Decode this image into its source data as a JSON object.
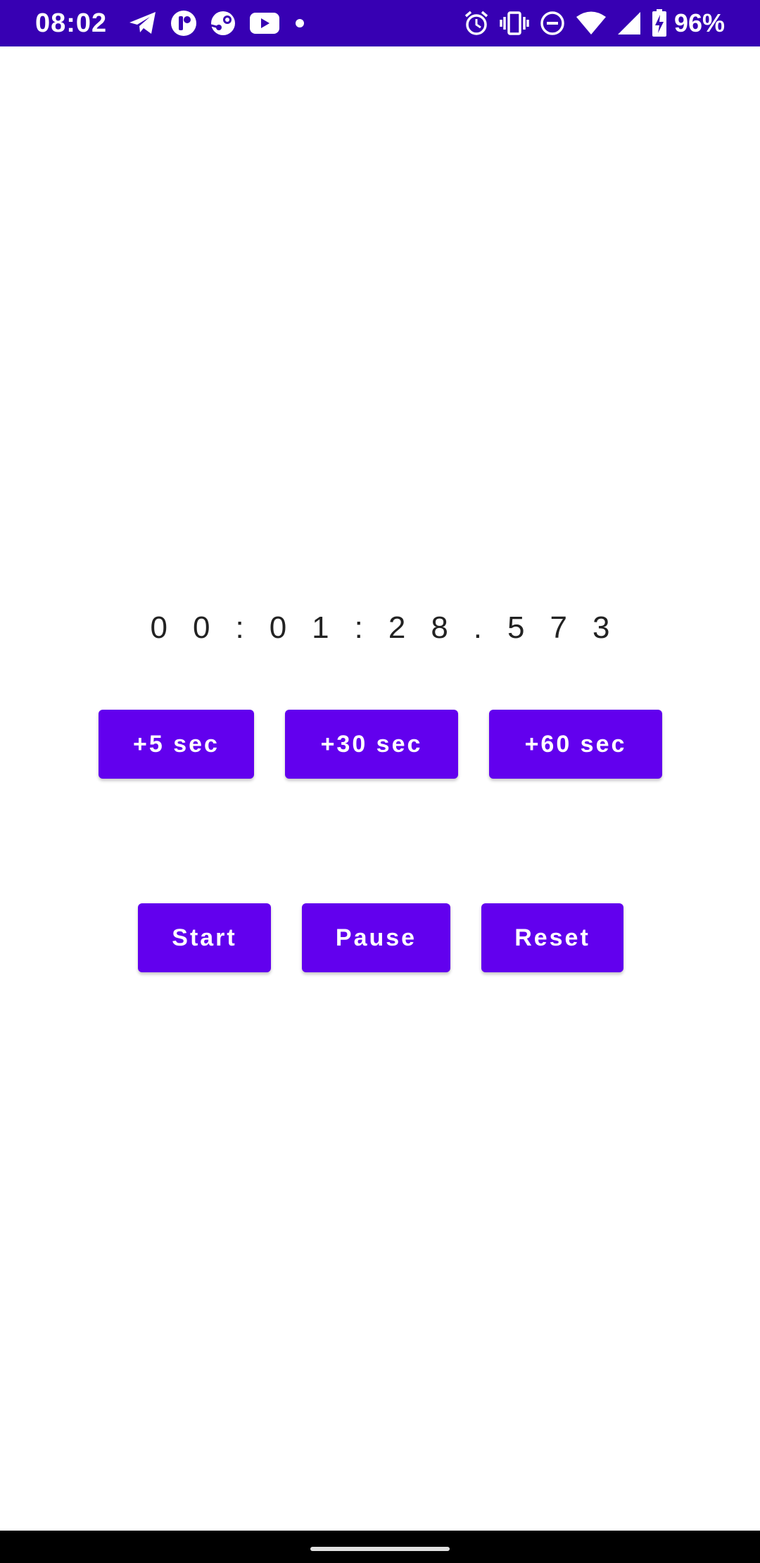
{
  "status_bar": {
    "time": "08:02",
    "battery_percent": "96%",
    "left_icons": [
      "telegram-icon",
      "app-icon",
      "steam-icon",
      "youtube-icon",
      "notification-dot-icon"
    ],
    "right_icons": [
      "alarm-icon",
      "vibrate-icon",
      "do-not-disturb-icon",
      "wifi-icon",
      "signal-icon",
      "battery-charging-icon"
    ],
    "background_color": "#3700b3"
  },
  "timer": {
    "display": "00:01:28.573"
  },
  "add_time_buttons": {
    "add_5_label": "+5 sec",
    "add_30_label": "+30 sec",
    "add_60_label": "+60 sec"
  },
  "controls": {
    "start_label": "Start",
    "pause_label": "Pause",
    "reset_label": "Reset"
  },
  "colors": {
    "accent": "#6200ee",
    "status_bar": "#3700b3"
  }
}
